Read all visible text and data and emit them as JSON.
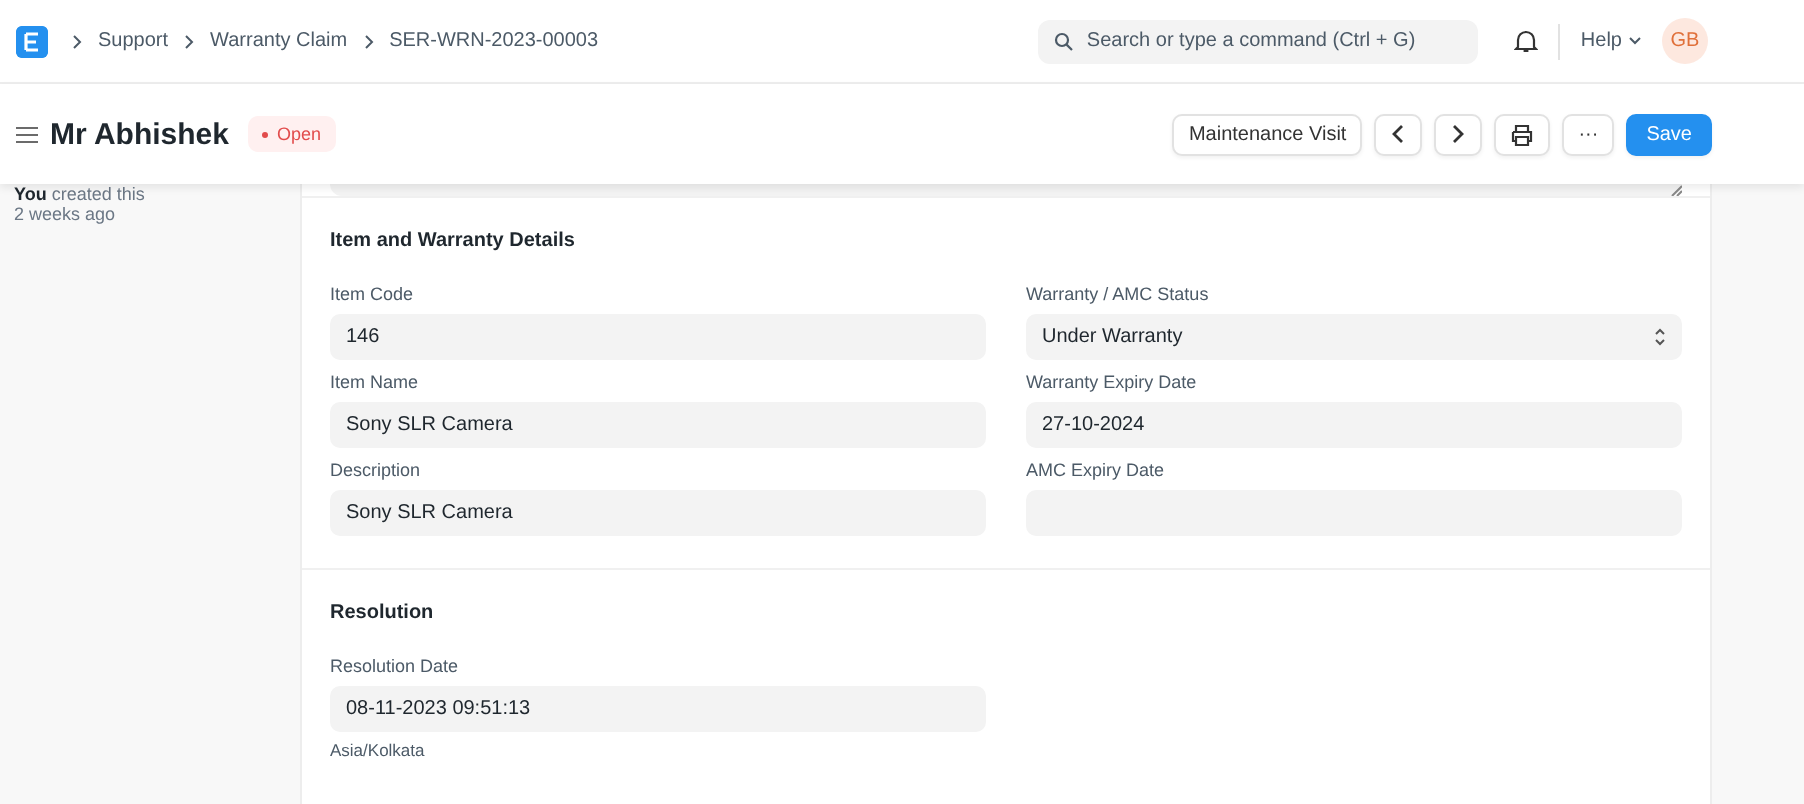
{
  "navbar": {
    "breadcrumbs": [
      "Support",
      "Warranty Claim",
      "SER-WRN-2023-00003"
    ],
    "search": {
      "placeholder": "Search or type a command (Ctrl + G)"
    },
    "help": "Help",
    "avatar": "GB"
  },
  "page_head": {
    "title": "Mr Abhishek",
    "status": "Open",
    "buttons": [
      {
        "kind": "text",
        "label": "Maintenance Visit"
      },
      {
        "kind": "prev"
      },
      {
        "kind": "next"
      },
      {
        "kind": "print"
      },
      {
        "kind": "more",
        "label": "···"
      },
      {
        "kind": "primary",
        "label": "Save"
      }
    ]
  },
  "sidebar": {
    "activity": [
      {
        "actor": "You",
        "text": "created this"
      }
    ],
    "time": "2 weeks ago"
  },
  "sections": [
    {
      "title": "Item and Warranty Details",
      "columns": [
        [
          {
            "label": "Item Code",
            "kind": "input",
            "value": "146"
          },
          {
            "label": "Item Name",
            "kind": "input",
            "value": "Sony SLR Camera"
          },
          {
            "label": "Description",
            "kind": "input",
            "value": "Sony SLR Camera"
          }
        ],
        [
          {
            "label": "Warranty / AMC Status",
            "kind": "select",
            "value": "Under Warranty"
          },
          {
            "label": "Warranty Expiry Date",
            "kind": "input",
            "value": "27-10-2024"
          },
          {
            "label": "AMC Expiry Date",
            "kind": "input"
          }
        ]
      ]
    },
    {
      "title": "Resolution",
      "columns": [
        [
          {
            "label": "Resolution Date",
            "kind": "input",
            "value": "08-11-2023 09:51:13",
            "note": "Asia/Kolkata"
          }
        ],
        []
      ]
    }
  ]
}
